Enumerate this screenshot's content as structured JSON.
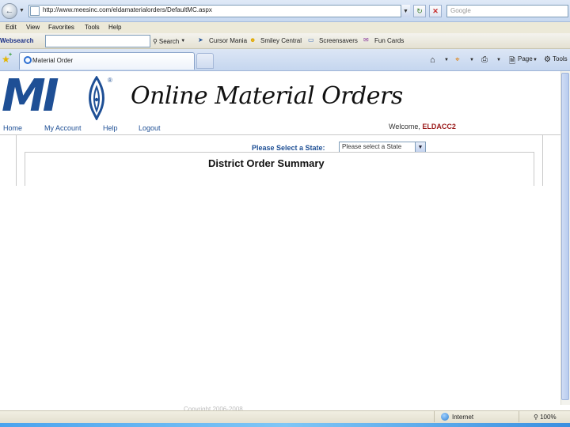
{
  "browser": {
    "url": "http://www.meesinc.com/eldamaterialorders/DefaultMC.aspx",
    "search_placeholder": "Google",
    "menu": [
      "Edit",
      "View",
      "Favorites",
      "Tools",
      "Help"
    ],
    "toolbar": {
      "websearch_label": "Websearch",
      "search_button": "Search",
      "items": [
        "Cursor Mania",
        "Smiley Central",
        "Screensavers",
        "Fun Cards"
      ]
    },
    "tab_title": "Material Order",
    "commands": [
      "Page",
      "Tools"
    ],
    "status": {
      "zone": "Internet",
      "zoom": "100%"
    }
  },
  "page": {
    "logo_text": "MI",
    "logo_registered": "®",
    "site_title": "Online Material Orders",
    "nav": [
      "Home",
      "My Account",
      "Help",
      "Logout"
    ],
    "welcome_prefix": "Welcome,",
    "username": "ELDACC2",
    "state_label": "Please Select a State:",
    "state_selected": "Please select a State",
    "summary_title": "District Order Summary",
    "footer": "Copyright 2006-2008 ..."
  }
}
